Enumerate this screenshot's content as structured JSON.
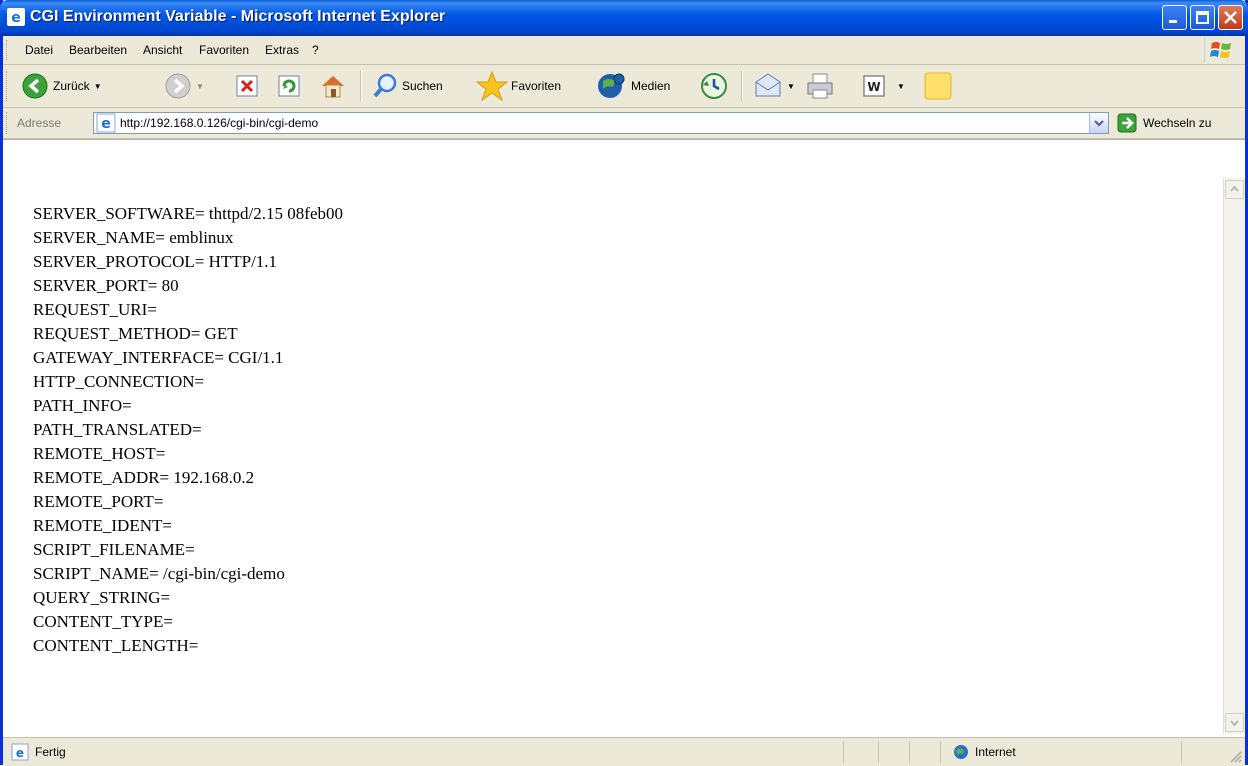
{
  "window": {
    "title": "CGI Environment Variable - Microsoft Internet Explorer"
  },
  "menu": {
    "items": [
      "Datei",
      "Bearbeiten",
      "Ansicht",
      "Favoriten",
      "Extras",
      "?"
    ]
  },
  "toolbar": {
    "back_label": "Zurück",
    "search_label": "Suchen",
    "favorites_label": "Favoriten",
    "media_label": "Medien"
  },
  "address": {
    "label": "Adresse",
    "url": "http://192.168.0.126/cgi-bin/cgi-demo",
    "go_label": "Wechseln zu"
  },
  "content": {
    "lines": [
      "SERVER_SOFTWARE= thttpd/2.15 08feb00",
      "SERVER_NAME= emblinux",
      "SERVER_PROTOCOL= HTTP/1.1",
      "SERVER_PORT= 80",
      "REQUEST_URI=",
      "REQUEST_METHOD= GET",
      "GATEWAY_INTERFACE= CGI/1.1",
      "HTTP_CONNECTION=",
      "PATH_INFO=",
      "PATH_TRANSLATED=",
      "REMOTE_HOST=",
      "REMOTE_ADDR= 192.168.0.2",
      "REMOTE_PORT=",
      "REMOTE_IDENT=",
      "SCRIPT_FILENAME=",
      "SCRIPT_NAME= /cgi-bin/cgi-demo",
      "QUERY_STRING=",
      "CONTENT_TYPE=",
      "CONTENT_LENGTH="
    ]
  },
  "status": {
    "text": "Fertig",
    "zone": "Internet"
  }
}
